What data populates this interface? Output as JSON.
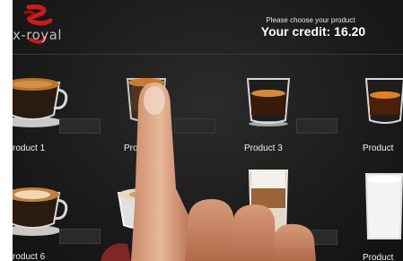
{
  "brand": {
    "logo_text": "x-royal"
  },
  "header": {
    "prompt": "Please choose your product",
    "credit": "Your credit: 16.20"
  },
  "products": [
    {
      "label": "roduct  1",
      "icon": "espresso-cup-icon"
    },
    {
      "label": "Pro",
      "icon": "espresso-glass-icon"
    },
    {
      "label": "Product  3",
      "icon": "espresso-glass-icon"
    },
    {
      "label": "Product",
      "icon": "espresso-glass-icon"
    },
    {
      "label": "roduct  6",
      "icon": "cappuccino-cup-icon"
    },
    {
      "label": "",
      "icon": "milk-coffee-cup-icon"
    },
    {
      "label": "",
      "icon": "latte-macchiato-glass-icon"
    },
    {
      "label": "Product",
      "icon": "milk-glass-icon"
    }
  ]
}
